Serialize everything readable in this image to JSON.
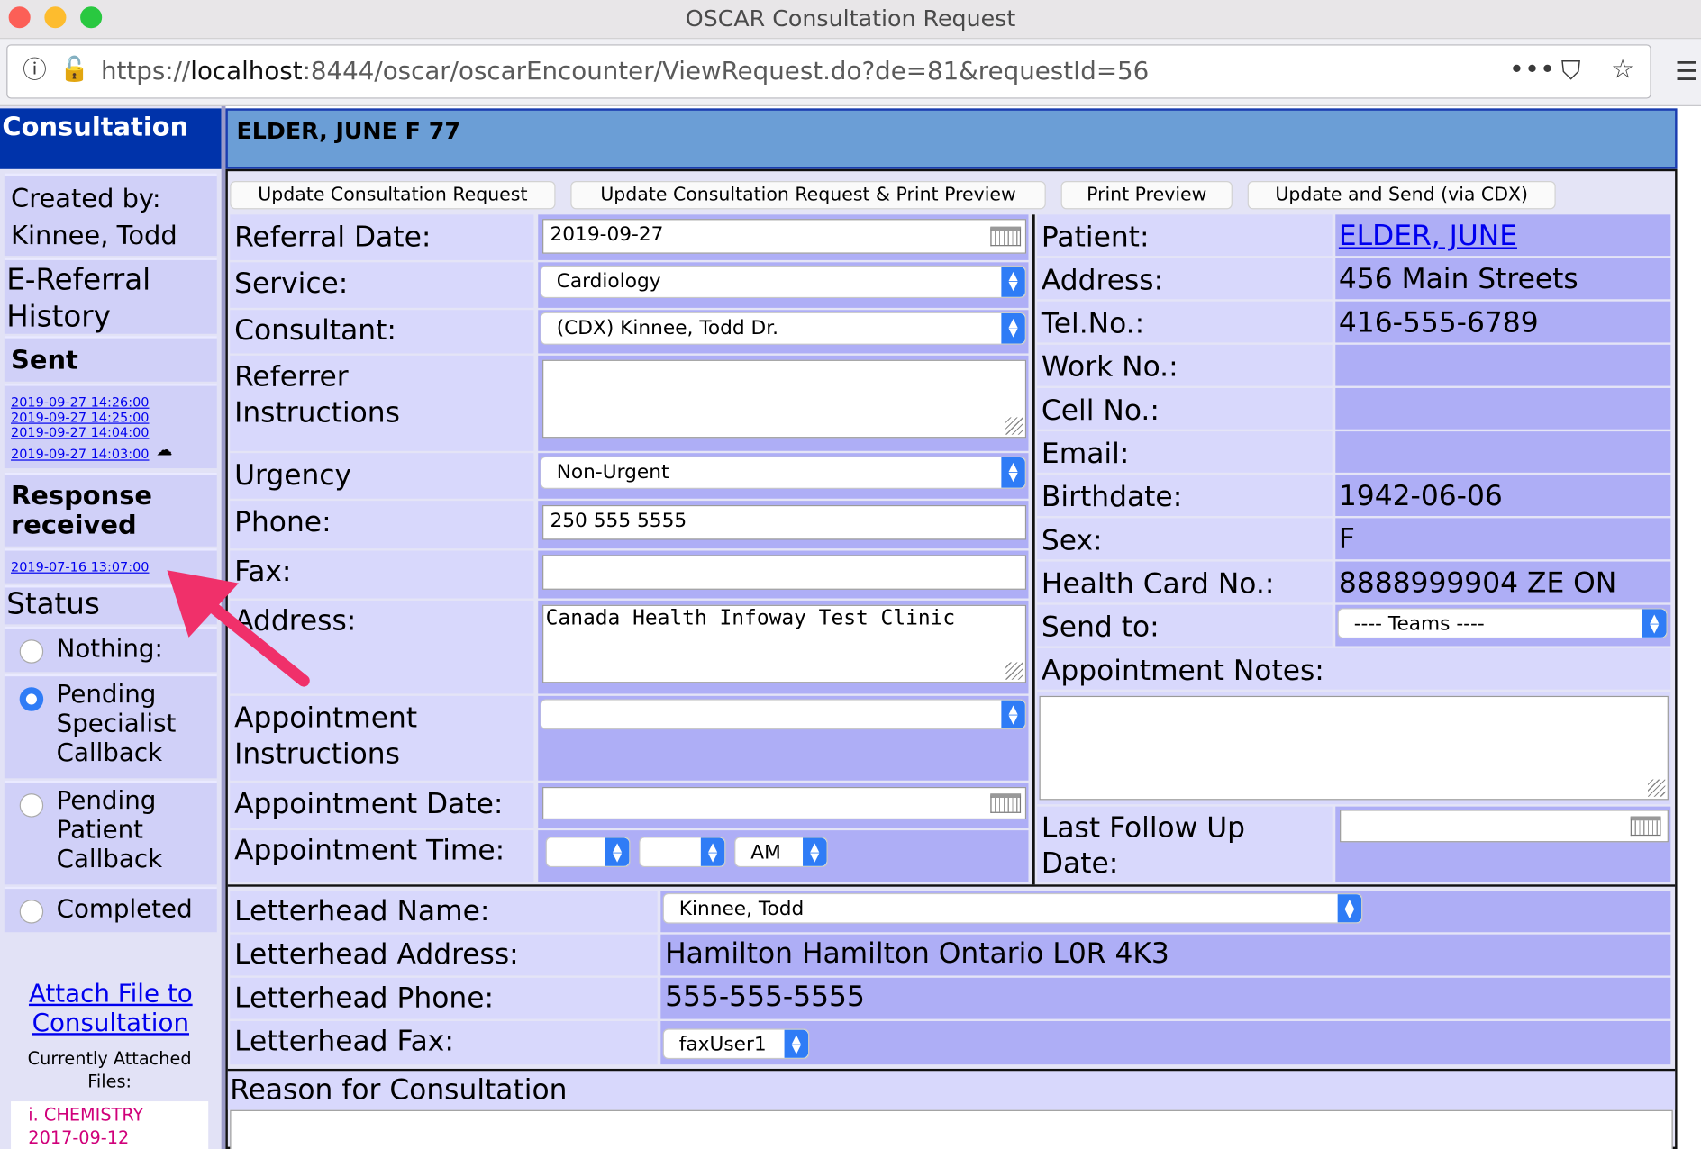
{
  "window": {
    "title": "OSCAR Consultation Request"
  },
  "url": {
    "prefix": "https://",
    "host": "localhost",
    "rest": ":8444/oscar/oscarEncounter/ViewRequest.do?de=81&requestId=56"
  },
  "sidebar": {
    "heading": "Consultation",
    "created_by_label": "Created by:",
    "created_by_name": "Kinnee, Todd",
    "ereferral": "E-Referral History",
    "sent_heading": "Sent",
    "sent_dates": [
      "2019-09-27 14:26:00",
      "2019-09-27 14:25:00",
      "2019-09-27 14:04:00",
      "2019-09-27 14:03:00"
    ],
    "response_heading": "Response received",
    "response_dates": [
      "2019-07-16 13:07:00"
    ],
    "status_heading": "Status",
    "status_options": [
      "Nothing:",
      "Pending Specialist Callback",
      "Pending Patient Callback",
      "Completed"
    ],
    "status_selected": "Pending Specialist Callback",
    "attach_link": "Attach File to Consultation",
    "attached_label": "Currently Attached Files:",
    "attached_files": [
      "i. CHEMISTRY 2017-09-12"
    ]
  },
  "header": {
    "patient_line": "ELDER, JUNE F 77"
  },
  "toolbar": {
    "update": "Update Consultation Request",
    "update_print": "Update Consultation Request & Print Preview",
    "print": "Print Preview",
    "send": "Update and Send (via CDX)"
  },
  "form": {
    "referral_date_label": "Referral Date:",
    "referral_date": "2019-09-27",
    "service_label": "Service:",
    "service": "Cardiology",
    "consultant_label": "Consultant:",
    "consultant": "(CDX) Kinnee, Todd Dr.",
    "referrer_label": "Referrer Instructions",
    "urgency_label": "Urgency",
    "urgency": "Non-Urgent",
    "phone_label": "Phone:",
    "phone": "250 555 5555",
    "fax_label": "Fax:",
    "fax": "",
    "address_label": "Address:",
    "address": "Canada Health Infoway Test Clinic",
    "appt_instr_label": "Appointment Instructions",
    "appt_date_label": "Appointment Date:",
    "appt_time_label": "Appointment Time:",
    "appt_ampm": "AM"
  },
  "patient": {
    "patient_label": "Patient:",
    "name": "ELDER, JUNE",
    "address_label": "Address:",
    "address": "456 Main Streets",
    "tel_label": "Tel.No.:",
    "tel": "416-555-6789",
    "work_label": "Work No.:",
    "cell_label": "Cell No.:",
    "email_label": "Email:",
    "birth_label": "Birthdate:",
    "birthdate": "1942-06-06",
    "sex_label": "Sex:",
    "sex": "F",
    "hc_label": "Health Card No.:",
    "health_card": "8888999904 ZE ON",
    "sendto_label": "Send to:",
    "send_to": "---- Teams ----",
    "appt_notes_label": "Appointment Notes:",
    "followup_label": "Last Follow Up Date:"
  },
  "letterhead": {
    "name_label": "Letterhead Name:",
    "name": "Kinnee, Todd",
    "address_label": "Letterhead Address:",
    "address": "Hamilton Hamilton Ontario L0R 4K3",
    "phone_label": "Letterhead Phone:",
    "phone": "555-555-5555",
    "fax_label": "Letterhead Fax:",
    "fax": "faxUser1"
  },
  "reason_label": "Reason for Consultation",
  "colors": {
    "accent_blue": "#2f7cf6",
    "nav_blue": "#0033aa",
    "annotation_arrow": "#f0306a"
  }
}
